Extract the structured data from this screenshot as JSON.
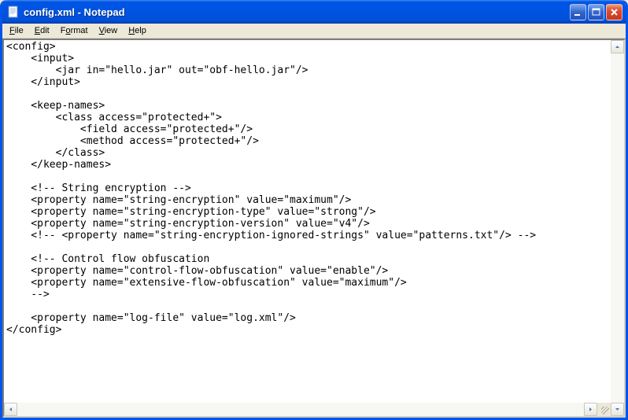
{
  "window": {
    "title": "config.xml - Notepad"
  },
  "menu": {
    "file": "File",
    "edit": "Edit",
    "format": "Format",
    "view": "View",
    "help": "Help"
  },
  "content": "<config>\n    <input>\n        <jar in=\"hello.jar\" out=\"obf-hello.jar\"/>\n    </input>\n\n    <keep-names>\n        <class access=\"protected+\">\n            <field access=\"protected+\"/>\n            <method access=\"protected+\"/>\n        </class>\n    </keep-names>\n\n    <!-- String encryption -->\n    <property name=\"string-encryption\" value=\"maximum\"/>\n    <property name=\"string-encryption-type\" value=\"strong\"/>\n    <property name=\"string-encryption-version\" value=\"v4\"/>\n    <!-- <property name=\"string-encryption-ignored-strings\" value=\"patterns.txt\"/> -->\n\n    <!-- Control flow obfuscation\n    <property name=\"control-flow-obfuscation\" value=\"enable\"/>\n    <property name=\"extensive-flow-obfuscation\" value=\"maximum\"/>\n    -->\n\n    <property name=\"log-file\" value=\"log.xml\"/>\n</config>"
}
